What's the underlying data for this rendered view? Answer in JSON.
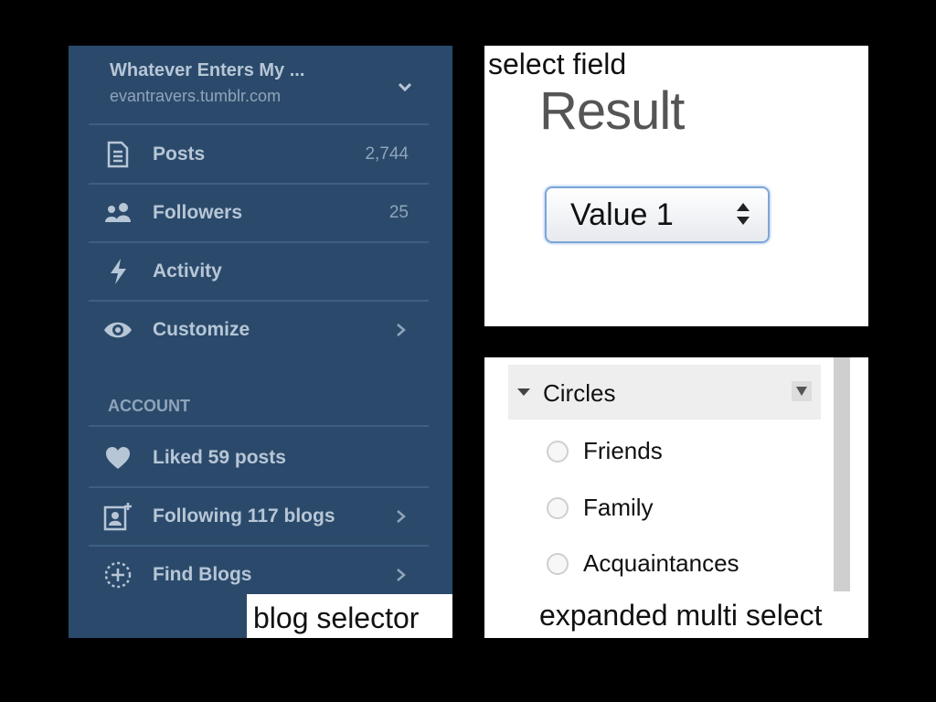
{
  "blog_panel": {
    "title": "Whatever Enters My ...",
    "url": "evantravers.tumblr.com",
    "items": [
      {
        "label": "Posts",
        "count": "2,744",
        "icon": "document-icon"
      },
      {
        "label": "Followers",
        "count": "25",
        "icon": "people-icon"
      },
      {
        "label": "Activity",
        "icon": "lightning-icon"
      },
      {
        "label": "Customize",
        "icon": "eye-icon"
      }
    ],
    "account_header": "ACCOUNT",
    "account_items": [
      {
        "label": "Liked 59 posts",
        "icon": "heart-icon"
      },
      {
        "label": "Following 117 blogs",
        "icon": "add-person-icon"
      },
      {
        "label": "Find Blogs",
        "icon": "find-blogs-icon"
      }
    ],
    "caption": "blog selector",
    "colors": {
      "background": "#2b4a6b",
      "text": "#b7c6d6"
    }
  },
  "select_panel": {
    "caption": "select field",
    "title": "Result",
    "select_value": "Value 1"
  },
  "multi_panel": {
    "header": "Circles",
    "options": [
      "Friends",
      "Family",
      "Acquaintances"
    ],
    "caption": "expanded multi select"
  }
}
